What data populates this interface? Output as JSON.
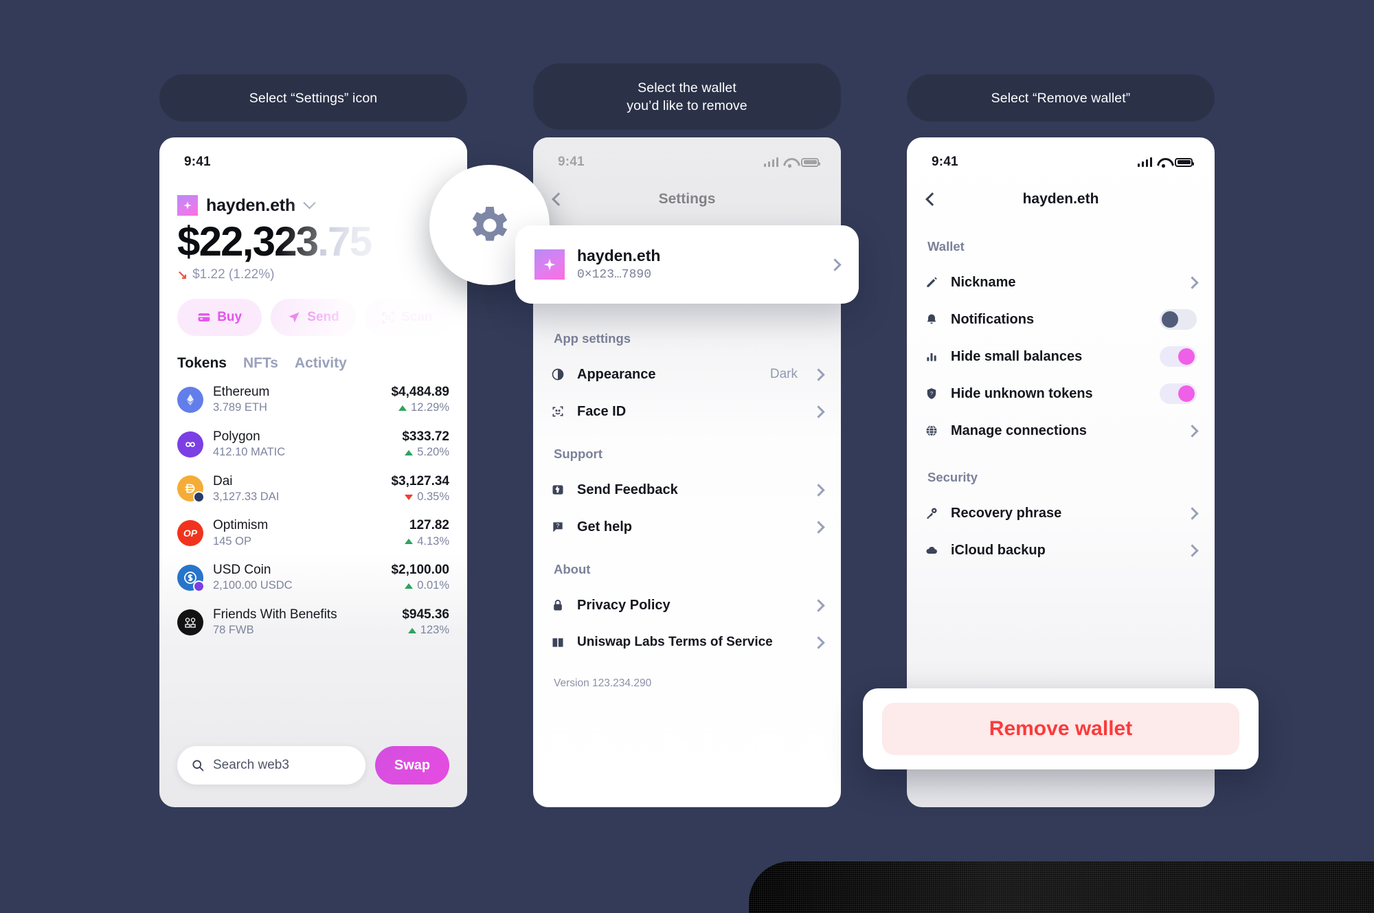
{
  "background_color": "#333b58",
  "instructions": [
    {
      "text": "Select “Settings” icon"
    },
    {
      "text_line1": "Select the wallet",
      "text_line2": "you’d like to remove"
    },
    {
      "text": "Select “Remove wallet”"
    }
  ],
  "phone1": {
    "status": {
      "time": "9:41"
    },
    "wallet": {
      "name": "hayden.eth"
    },
    "balance": {
      "main": "$22,323",
      "cents": ".75"
    },
    "delta": {
      "arrow": "↘",
      "text": "$1.22 (1.22%)"
    },
    "actions": [
      {
        "label": "Buy",
        "icon": "card-icon"
      },
      {
        "label": "Send",
        "icon": "paper-plane-icon"
      },
      {
        "label": "Scan",
        "icon": "scan-icon"
      }
    ],
    "tabs": [
      {
        "label": "Tokens",
        "active": true
      },
      {
        "label": "NFTs",
        "active": false
      },
      {
        "label": "Activity",
        "active": false
      }
    ],
    "tokens": [
      {
        "name": "Ethereum",
        "amount": "3.789 ETH",
        "value": "$4,484.89",
        "change": "12.29%",
        "direction": "up",
        "color": "#627eea"
      },
      {
        "name": "Polygon",
        "amount": "412.10 MATIC",
        "value": "$333.72",
        "change": "5.20%",
        "direction": "up",
        "color": "#7b3fe4"
      },
      {
        "name": "Dai",
        "amount": "3,127.33 DAI",
        "value": "$3,127.34",
        "change": "0.35%",
        "direction": "down",
        "color": "#f5ac37"
      },
      {
        "name": "Optimism",
        "amount": "145 OP",
        "value": "127.82",
        "change": "4.13%",
        "direction": "up",
        "color": "#f1331e"
      },
      {
        "name": "USD Coin",
        "amount": "2,100.00 USDC",
        "value": "$2,100.00",
        "change": "0.01%",
        "direction": "up",
        "color": "#2775ca"
      },
      {
        "name": "Friends With Benefits",
        "amount": "78 FWB",
        "value": "$945.36",
        "change": "123%",
        "direction": "up",
        "color": "#121212"
      }
    ],
    "search": {
      "placeholder": "Search web3",
      "icon": "search-icon"
    },
    "swap": {
      "label": "Swap"
    },
    "gear": {
      "icon": "gear-icon"
    }
  },
  "phone2": {
    "status": {
      "time": "9:41"
    },
    "nav": {
      "title": "Settings",
      "back_icon": "chevron-left-icon"
    },
    "wallet_card": {
      "name": "hayden.eth",
      "address": "0×123…7890",
      "chevron": "chevron-right-icon"
    },
    "sections": [
      {
        "label": "App settings",
        "rows": [
          {
            "label": "Appearance",
            "value": "Dark",
            "icon": "contrast-icon",
            "chevron": true
          },
          {
            "label": "Face ID",
            "value": "",
            "icon": "face-id-icon",
            "chevron": true
          }
        ]
      },
      {
        "label": "Support",
        "rows": [
          {
            "label": "Send Feedback",
            "value": "",
            "icon": "thumbs-up-icon",
            "chevron": true
          },
          {
            "label": "Get help",
            "value": "",
            "icon": "question-bubble-icon",
            "chevron": true
          }
        ]
      },
      {
        "label": "About",
        "rows": [
          {
            "label": "Privacy Policy",
            "value": "",
            "icon": "lock-icon",
            "chevron": true
          },
          {
            "label": "Uniswap Labs Terms of Service",
            "value": "",
            "icon": "book-icon",
            "chevron": true
          }
        ]
      }
    ],
    "version": "Version 123.234.290"
  },
  "phone3": {
    "status": {
      "time": "9:41"
    },
    "nav": {
      "title": "hayden.eth",
      "back_icon": "chevron-left-icon"
    },
    "sections": [
      {
        "label": "Wallet",
        "rows": [
          {
            "label": "Nickname",
            "icon": "pencil-icon",
            "control": "chevron"
          },
          {
            "label": "Notifications",
            "icon": "bell-icon",
            "control": "toggle-off"
          },
          {
            "label": "Hide small balances",
            "icon": "bar-chart-icon",
            "control": "toggle-on"
          },
          {
            "label": "Hide unknown tokens",
            "icon": "shield-question-icon",
            "control": "toggle-on"
          },
          {
            "label": "Manage connections",
            "icon": "globe-icon",
            "control": "chevron"
          }
        ]
      },
      {
        "label": "Security",
        "rows": [
          {
            "label": "Recovery phrase",
            "icon": "key-icon",
            "control": "chevron"
          },
          {
            "label": "iCloud backup",
            "icon": "cloud-icon",
            "control": "chevron"
          }
        ]
      }
    ],
    "remove_button": {
      "label": "Remove wallet",
      "color": "#fb3b3b"
    }
  }
}
